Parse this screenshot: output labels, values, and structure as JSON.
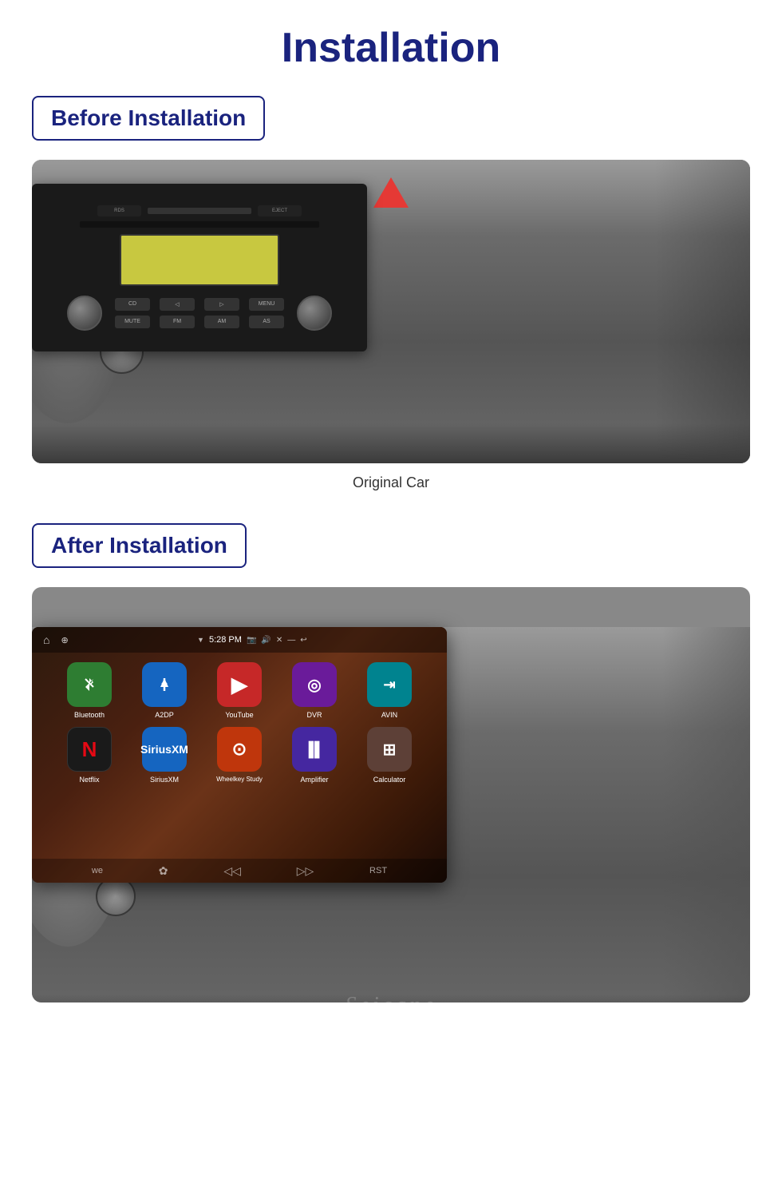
{
  "page": {
    "title": "Installation",
    "before_label": "Before Installation",
    "after_label": "After Installation",
    "caption": "Original Car",
    "brand": "Seicane"
  },
  "status_bar": {
    "time": "5:28 PM",
    "wifi_symbol": "▼"
  },
  "apps_row1": [
    {
      "id": "bluetooth",
      "label": "Bluetooth",
      "icon": "⚡",
      "bg": "bg-green"
    },
    {
      "id": "a2dp",
      "label": "A2DP",
      "icon": "✱",
      "bg": "bg-blue-bt"
    },
    {
      "id": "youtube",
      "label": "YouTube",
      "icon": "▶",
      "bg": "bg-red"
    },
    {
      "id": "dvr",
      "label": "DVR",
      "icon": "◎",
      "bg": "bg-purple"
    },
    {
      "id": "avin",
      "label": "AVIN",
      "icon": "≡",
      "bg": "bg-cyan"
    }
  ],
  "apps_row2": [
    {
      "id": "netflix",
      "label": "Netflix",
      "icon": "N",
      "bg": "bg-netflix"
    },
    {
      "id": "siriusxm",
      "label": "SiriusXM",
      "icon": "⊕",
      "bg": "bg-sirius"
    },
    {
      "id": "wheelkey",
      "label": "Wheelkey Study",
      "icon": "⊙",
      "bg": "bg-brown-wk"
    },
    {
      "id": "amplifier",
      "label": "Amplifier",
      "icon": "▌▌",
      "bg": "bg-purple-amp"
    },
    {
      "id": "calculator",
      "label": "Calculator",
      "icon": "⊞",
      "bg": "bg-brown-calc"
    }
  ],
  "hazard_color": "#e53935",
  "before_section": {
    "image_alt": "Original car radio unit"
  },
  "after_section": {
    "image_alt": "After Android head unit installation"
  }
}
